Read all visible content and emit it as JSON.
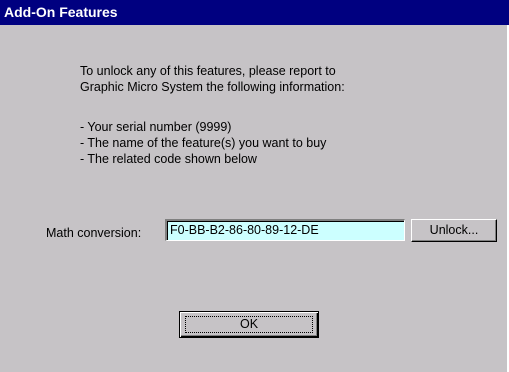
{
  "window": {
    "title": "Add-On Features"
  },
  "message": {
    "line1": "To unlock any of this features, please report to",
    "line2": "Graphic Micro System the following information:",
    "bullet1": "- Your serial number (9999)",
    "bullet2": "- The name of the feature(s) you want to buy",
    "bullet3": "- The related code shown below"
  },
  "feature": {
    "label": "Math conversion:",
    "code": "F0-BB-B2-86-80-89-12-DE",
    "unlock_label": "Unlock..."
  },
  "footer": {
    "ok_label": "OK"
  },
  "colors": {
    "titlebar": "#000080",
    "dialog_face": "#c6c3c6",
    "code_field_bg": "#ccffff"
  }
}
